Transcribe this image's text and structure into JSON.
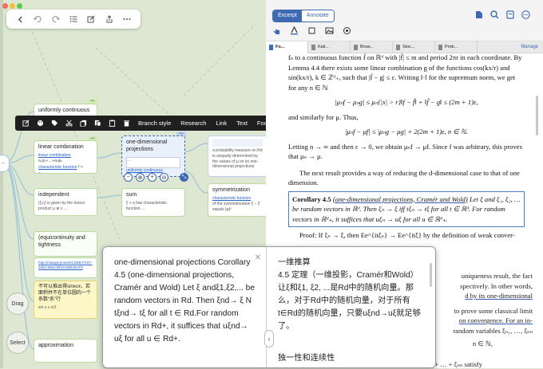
{
  "toolbar": {
    "icons": [
      "chevron-left-icon",
      "undo-icon",
      "redo-icon",
      "list-icon",
      "edit-icon",
      "share-icon",
      "more-icon"
    ]
  },
  "cards": {
    "uniformly": {
      "title": "uniformly continuous"
    },
    "linear": {
      "title": "linear combination",
      "link": "linear combination",
      "formula": "a₁φ₁+…+aₙφₙ",
      "link2": "characteristic function",
      "tail": "f = ∑aₖφₖ"
    },
    "independent": {
      "title": "independent",
      "text": "(ξ,η) is given by the tensor product μ ⊗ ν …"
    },
    "equicontinuity": {
      "title": "(equicontinuity and tightness"
    },
    "http": {
      "text": "http://mlaage.jinote/tiCD8B-FC07-48b0-9563-BFDA88846AF8"
    },
    "chinese": {
      "title": "不可以推出得sinx≤x，若面积并不在单位圆的一个系数“系”行",
      "text": "sin x ≤ x/2"
    },
    "approximation": {
      "title": "approximation"
    },
    "onedim": {
      "title": "one-dimensional projections",
      "text": "…",
      "link": "uniformly continuous"
    },
    "sum": {
      "title": "sum",
      "text": "ξ + η has characteristic function …"
    },
    "right_top": {
      "text": "a probability measure on Rd is uniquely determined by the values of μ on its one-dimensional projections"
    },
    "symmetrization": {
      "title": "symmetrization",
      "link": "characteristic function",
      "text": "of the symmetrization ξ − ξ′ equals |φ|²"
    }
  },
  "context_menu": {
    "items": [
      "Branch style",
      "Research",
      "Link",
      "Text",
      "Focus"
    ]
  },
  "side_labels": {
    "drag": "Drag",
    "select": "Select"
  },
  "reader": {
    "segment": {
      "excerpt": "Excerpt",
      "annotate": "Annotate"
    },
    "tabs": [
      "Fo...",
      "Kali...",
      "Brow...",
      "Stoc...",
      "Prob..."
    ],
    "manage": "Manage",
    "doc": {
      "p1": "fₙ to a continuous function f̃ on ℝᵈ with |f̃| ≤ m and period 2πr in each coordinate. By Lemma 4.4 there exists some linear combination g of the functions cos(kx/r) and sin(kx/r), k ∈ ℤᵈ₊, such that |f̃ − g| ≤ ε. Writing ‖·‖ for the supremum norm, we get for any n ∈ ℕ",
      "eq1": "|μₙf − μₙg| ≤ μₙ{|x| > r}‖f − f̃‖ + ‖f̃ − g‖ ≤ (2m + 1)ε,",
      "p2": "and similarly for μ. Thus,",
      "eq2": "|μₙf − μf| ≤ |μₙg − μg| + 2(2m + 1)ε,   n ∈ ℕ.",
      "p3": "Letting n → ∞ and then ε → 0, we obtain μₙf → μf. Since f was arbitrary, this proves that μₙ → μ.",
      "p4": "The next result provides a way of reducing the d-dimensional case to that of one dimension.",
      "cor_title": "Corollary 4.5",
      "cor_sub": "(one-dimensional projections, Cramér and Wold)",
      "cor_body": "Let ξ and ξ₁, ξ₂, … be random vectors in ℝᵈ. Then ξₙ → ξ iff tξₙ → tξ for all t ∈ ℝᵈ. For random vectors in ℝᵈ₊, it suffices that uξₙ → uξ for all u ∈ ℝᵈ₊.",
      "proof": "Proof: If ξₙ → ξ, then Ee^{itξₙ} → Ee^{itξ} by the definition of weak conver-",
      "p5a": "uniqueness result, the fact",
      "p5b": "spectively. In other words,",
      "p5c": "d by its one-dimensional",
      "p6a": "to prove some classical limit",
      "p6b": "on convergence. For an in-",
      "p6c": "random variables ξₙ₁, …, ξₙₙ",
      "p7": "n ∈ ℕ,",
      "p8": "and assume that nε → c ≤ ∞. Then the sums Sₙ = ξₙ₁ + … + ξₙₙ satisfy"
    }
  },
  "translation": {
    "source": "one-dimensional projections Corollary 4.5 (one-dimensional projections, Cramér and Wold) Let ξ andξ1,ξ2,... be random vectors in Rd. Then ξnd→ ξ N tξnd→ tξ for all t ∈ Rd.For random vectors in Rd+, it suffices that uξnd→ uξ for all u ∈ Rd+.",
    "target": "一维推算\n4.5 定理（一维投影，Cramér和Wold）让ξ和ξ1, ξ2, ...是Rd中的随机向量。那么，对于Rd中的随机向量，对于所有t∈Rd的随机向量，只要uξnd→uξ就足够了。",
    "target_more": "独一性和连续性"
  }
}
